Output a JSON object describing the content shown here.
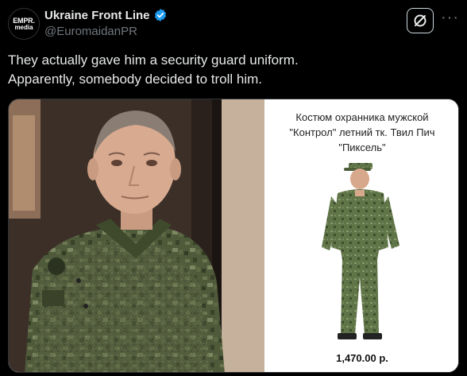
{
  "author": {
    "avatar_line1": "EMPR.",
    "avatar_line2": "media",
    "display_name": "Ukraine Front Line",
    "handle": "@EuromaidanPR",
    "verified": true
  },
  "toolbar": {
    "grok_icon": "slashed-circle-icon",
    "more_icon": "more-horizontal-icon",
    "more_label": "···"
  },
  "tweet": {
    "line1": "They actually gave him a security guard uniform.",
    "line2": "Apparently, somebody decided to troll him."
  },
  "media": {
    "product_title_line1": "Костюм охранника мужской",
    "product_title_line2": "\"Контрол\" летний тк. Твил Пич",
    "product_title_line3": "\"Пиксель\"",
    "price": "1,470.00 р."
  },
  "colors": {
    "background": "#000000",
    "text_primary": "#e7e9ea",
    "text_secondary": "#71767b",
    "verified_blue": "#1d9bf0",
    "camo_green": "#4f5a3a"
  }
}
